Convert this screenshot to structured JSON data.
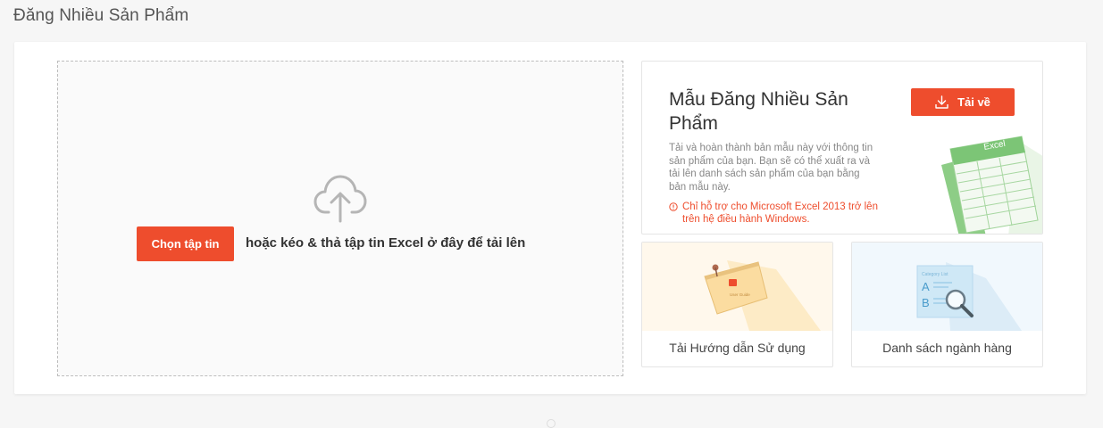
{
  "page": {
    "title": "Đăng Nhiều Sản Phẩm"
  },
  "upload": {
    "choose_button": "Chọn tập tin",
    "drop_hint": "hoặc kéo & thả tập tin Excel ở đây để tải lên",
    "icon": "cloud-upload-icon"
  },
  "template": {
    "title": "Mẫu Đăng Nhiều Sản Phẩm",
    "download_button": "Tải về",
    "description": "Tải và hoàn thành bản mẫu này với thông tin sản phẩm của bạn. Bạn sẽ có thể xuất ra và tải lên danh sách sản phẩm của bạn bằng bản mẫu này.",
    "note": "Chỉ hỗ trợ cho Microsoft Excel 2013 trở lên trên hệ điều hành Windows.",
    "illustration_label": "Excel"
  },
  "tiles": [
    {
      "label": "Tải Hướng dẫn Sử dụng",
      "illustration_text": "User Guide"
    },
    {
      "label": "Danh sách ngành hàng",
      "illustration_text": "Category List",
      "letters": [
        "A",
        "B"
      ]
    }
  ],
  "colors": {
    "accent": "#ee4d2d",
    "excel_green": "#7cc576"
  }
}
